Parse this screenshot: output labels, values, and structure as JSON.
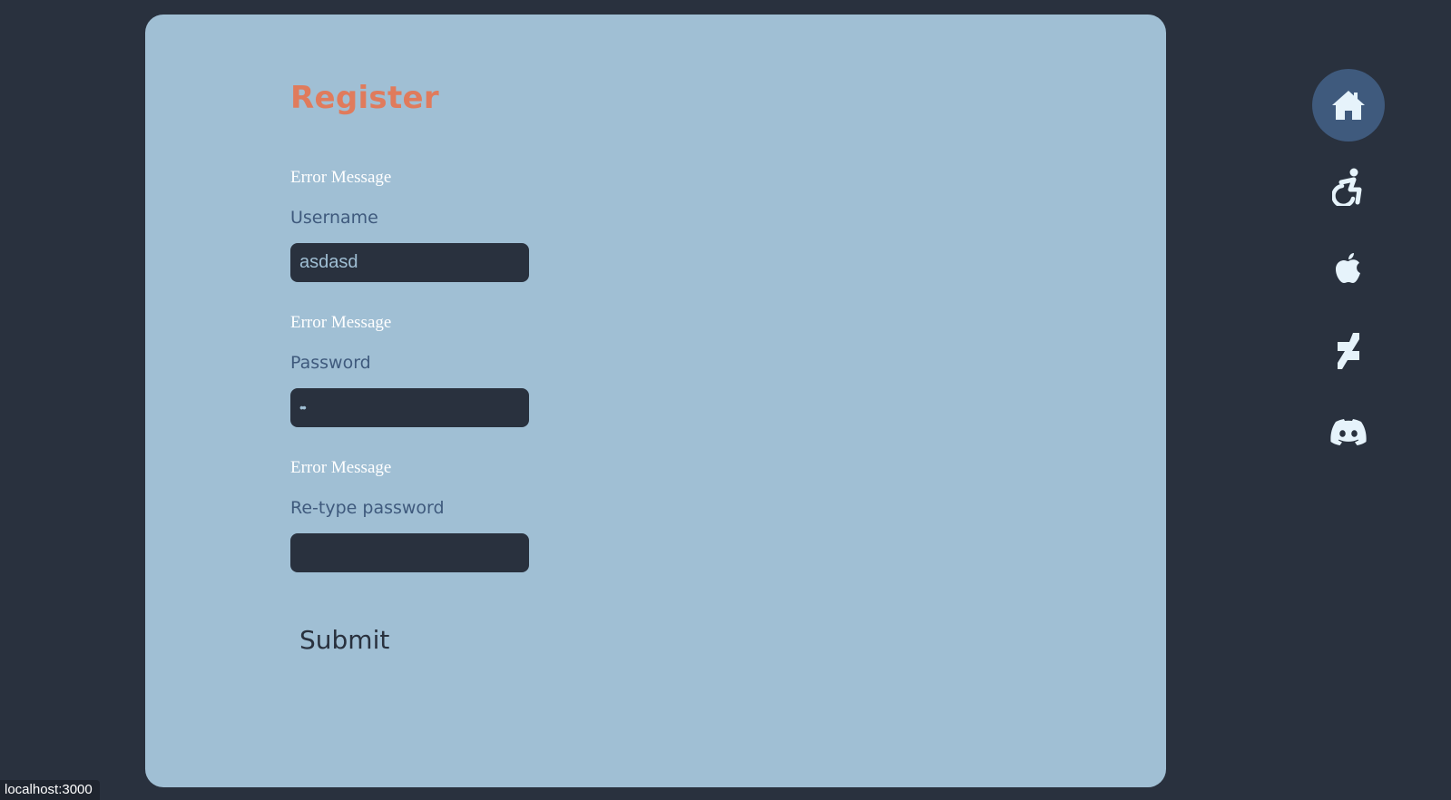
{
  "form": {
    "title": "Register",
    "fields": [
      {
        "error": "Error Message",
        "label": "Username",
        "value": "asdasd"
      },
      {
        "error": "Error Message",
        "label": "Password",
        "value": "••"
      },
      {
        "error": "Error Message",
        "label": "Re-type password",
        "value": ""
      }
    ],
    "submit_label": "Submit"
  },
  "sidebar": {
    "items": [
      {
        "icon": "home-icon",
        "active": true
      },
      {
        "icon": "accessibility-icon",
        "active": false
      },
      {
        "icon": "apple-icon",
        "active": false
      },
      {
        "icon": "deviantart-icon",
        "active": false
      },
      {
        "icon": "discord-icon",
        "active": false
      }
    ]
  },
  "status_bar": {
    "url": "localhost:3000"
  },
  "colors": {
    "background": "#29313e",
    "panel": "#a0bfd4",
    "title": "#e07b5c",
    "label": "#3f5a7d",
    "active_nav": "#3f5a7d",
    "icon": "#e6f3fb"
  }
}
